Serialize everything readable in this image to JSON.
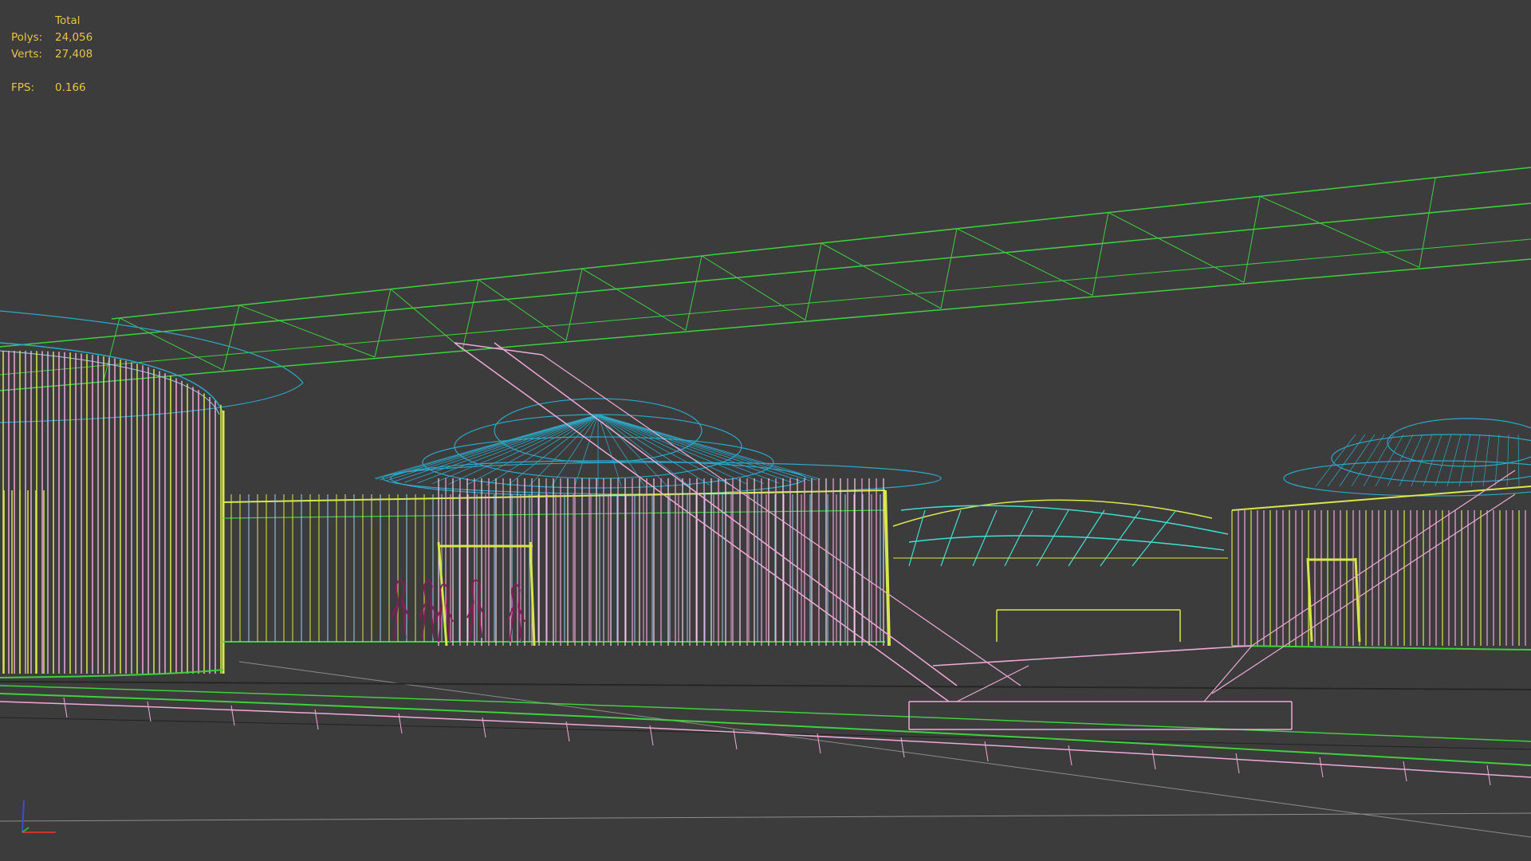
{
  "viewport": {
    "name": "perspective-wireframe-viewport",
    "background": "#3c3c3c"
  },
  "stats": {
    "header": "Total",
    "polys_label": "Polys:",
    "polys_value": "24,056",
    "verts_label": "Verts:",
    "verts_value": "27,408",
    "fps_label": "FPS:",
    "fps_value": "0.166",
    "color": "#e8c44a"
  },
  "wire_colors": {
    "green": "#3fcf3f",
    "cyan_blue": "#2fa7c7",
    "pink": "#f0a8d8",
    "yellow": "#d8e84a",
    "teal": "#3fe0d0",
    "light_blue": "#9ad0f0",
    "purple": "#8a1a5a",
    "grid": "#8c8c8c"
  },
  "axis_gizmo": {
    "icon": "axis-tripod-icon",
    "x_color": "#d03030",
    "y_color": "#30b030",
    "z_color": "#3050e0"
  }
}
